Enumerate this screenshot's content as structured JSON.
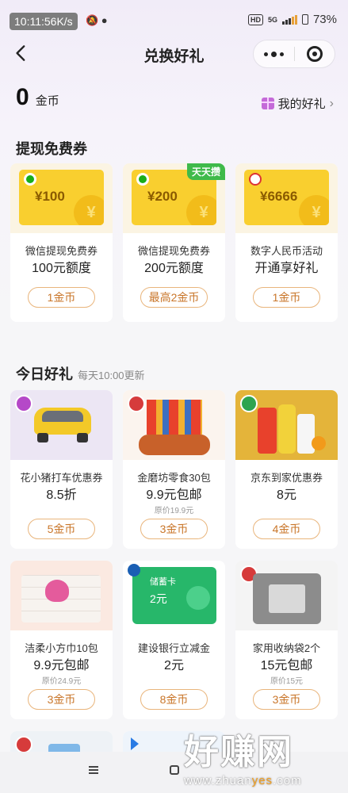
{
  "status": {
    "time": "10:11:56K/s",
    "hd": "HD",
    "network": "5G",
    "battery": "73%"
  },
  "nav": {
    "title": "兑换好礼"
  },
  "balance": {
    "amount": "0",
    "unit": "金币",
    "my_gifts": "我的好礼"
  },
  "section1": {
    "title": "提现免费券",
    "items": [
      {
        "voucher": "¥100",
        "line1": "微信提现免费券",
        "line2": "100元额度",
        "cost": "1金币",
        "coin": "¥"
      },
      {
        "voucher": "¥200",
        "badge": "天天攒",
        "line1": "微信提现免费券",
        "line2": "200元额度",
        "cost": "最高2金币",
        "coin": "¥"
      },
      {
        "voucher": "¥6666",
        "line1": "数字人民币活动",
        "line2": "开通享好礼",
        "cost": "1金币",
        "coin": "¥"
      }
    ]
  },
  "section2": {
    "title": "今日好礼",
    "subtitle": "每天10:00更新",
    "items": [
      {
        "line1": "花小猪打车优惠券",
        "line2": "8.5折",
        "orig": "",
        "cost": "5金币"
      },
      {
        "line1": "金磨坊零食30包",
        "line2": "9.9元包邮",
        "orig": "原价19.9元",
        "cost": "3金币"
      },
      {
        "line1": "京东到家优惠券",
        "line2": "8元",
        "orig": "",
        "cost": "4金币"
      },
      {
        "line1": "洁柔小方巾10包",
        "line2": "9.9元包邮",
        "orig": "原价24.9元",
        "cost": "3金币"
      },
      {
        "line1": "建设银行立减金",
        "line2": "2元",
        "orig": "",
        "cost": "8金币",
        "card_label": "储蓄卡",
        "card_amount": "2元"
      },
      {
        "line1": "家用收纳袋2个",
        "line2": "15元包邮",
        "orig": "原价15元",
        "cost": "3金币"
      }
    ]
  },
  "watermark": {
    "big": "好赚网",
    "url_a": "www.zhuan",
    "url_b": "yes",
    "url_c": ".com"
  },
  "colors": {
    "coin_border": "#e9b57c",
    "coin_text": "#c9762a",
    "voucher_yellow": "#f9cf2f"
  }
}
